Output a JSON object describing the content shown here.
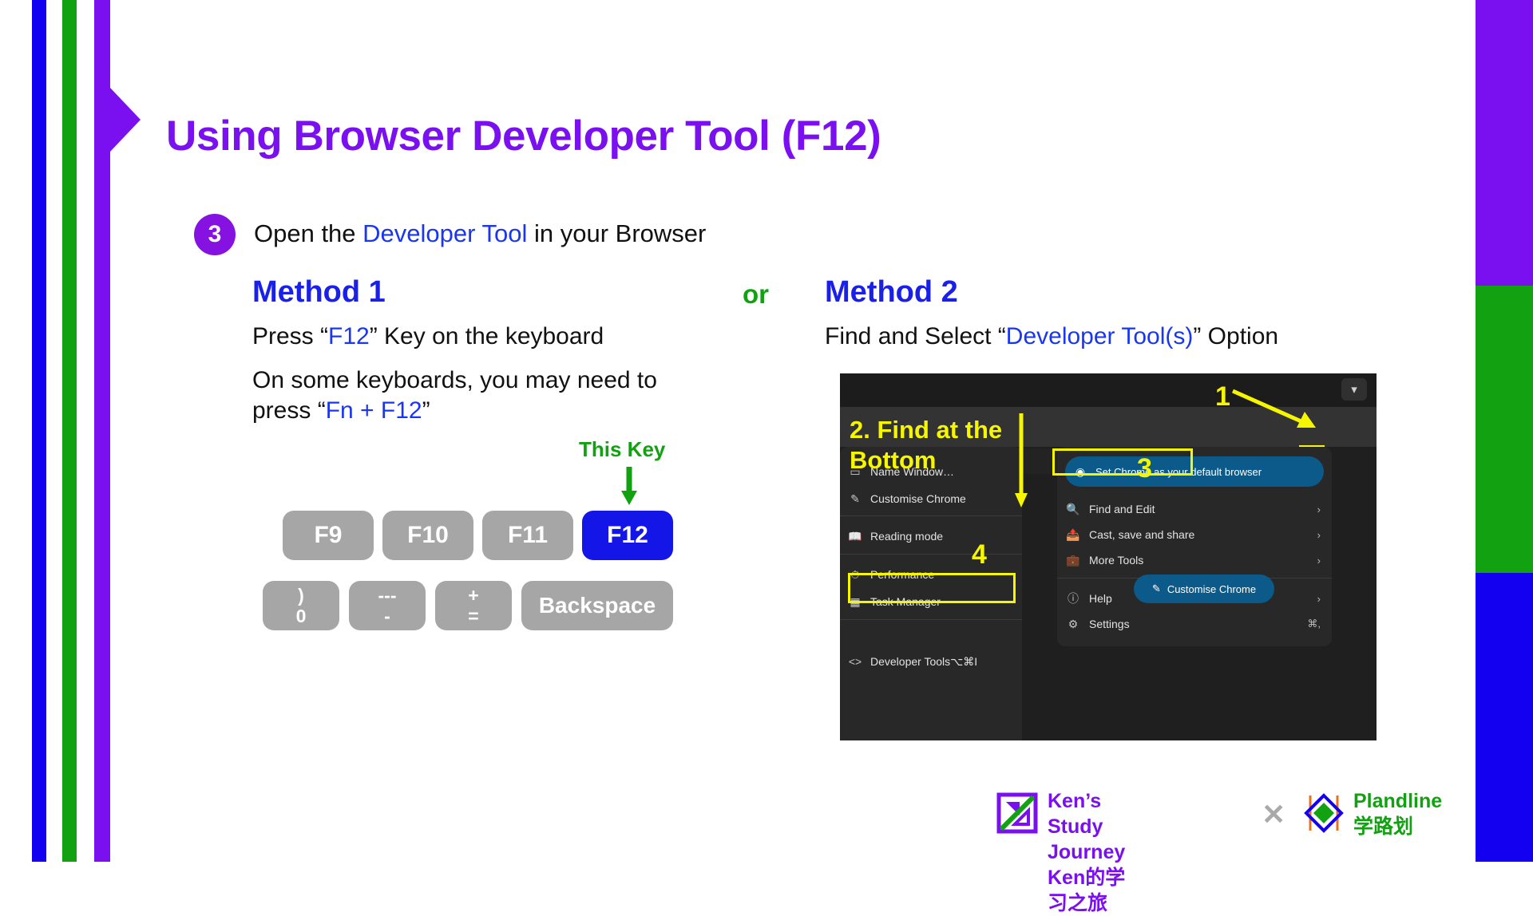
{
  "title": "Using Browser Developer Tool (F12)",
  "step": {
    "number": "3",
    "text_before": "Open the ",
    "highlight": "Developer Tool",
    "text_after": " in your Browser"
  },
  "methods": {
    "or_label": "or",
    "method1": {
      "heading": "Method 1",
      "line1_before": "Press “",
      "line1_key": "F12",
      "line1_after": "” Key on the keyboard",
      "line2_before": "On some keyboards, you may need to press “",
      "line2_key": "Fn + F12",
      "line2_after": "”"
    },
    "method2": {
      "heading": "Method 2",
      "line1_before": "Find and Select “",
      "line1_key": "Developer Tool(s)",
      "line1_after": "” Option"
    }
  },
  "keyboard": {
    "annotation_label": "This Key",
    "row1": [
      {
        "label": "F9",
        "highlighted": false
      },
      {
        "label": "F10",
        "highlighted": false
      },
      {
        "label": "F11",
        "highlighted": false
      },
      {
        "label": "F12",
        "highlighted": true
      }
    ],
    "row2": [
      {
        "top": ")",
        "bottom": "0"
      },
      {
        "top": "---",
        "bottom": "-"
      },
      {
        "top": "+",
        "bottom": "="
      },
      {
        "label": "Backspace"
      }
    ]
  },
  "chrome_menu": {
    "annotations": {
      "num1": "1",
      "find_at_bottom": "2. Find at the Bottom",
      "num3": "3",
      "num4": "4"
    },
    "toolbar": {
      "star_icon": "star-icon",
      "leaf_icon": "leaf-icon",
      "avatar_icon": "avatar-icon",
      "kebab_icon": "three-dot-menu-icon",
      "chevron_icon": "chevron-down-icon"
    },
    "left_menu": [
      {
        "icon": "window-icon",
        "label": "Name Window…"
      },
      {
        "icon": "pencil-icon",
        "label": "Customise Chrome"
      },
      {
        "icon": "book-icon",
        "label": "Reading mode"
      },
      {
        "icon": "gauge-icon",
        "label": "Performance"
      },
      {
        "icon": "grid-icon",
        "label": "Task Manager"
      },
      {
        "icon": "code-icon",
        "label": "Developer Tools",
        "shortcut": "⌥⌘I"
      }
    ],
    "default_browser_button": {
      "icon": "chrome-icon",
      "label": "Set Chrome as your default browser"
    },
    "submenu": [
      {
        "icon": "find-icon",
        "label": "Find and Edit",
        "arrow": "›"
      },
      {
        "icon": "cast-icon",
        "label": "Cast, save and share",
        "arrow": "›"
      },
      {
        "icon": "tools-icon",
        "label": "More Tools",
        "arrow": "›"
      },
      {
        "icon": "help-icon",
        "label": "Help",
        "arrow": "›"
      },
      {
        "icon": "gear-icon",
        "label": "Settings",
        "shortcut": "⌘,"
      }
    ],
    "customise_pill": {
      "icon": "pencil-icon",
      "label": "Customise Chrome"
    }
  },
  "footer": {
    "ken": {
      "line1": "Ken’s Study Journey",
      "line2": "Ken的学习之旅"
    },
    "separator": "✕",
    "plandline": {
      "line1": "Plandline",
      "line2": "学路划"
    }
  },
  "colors": {
    "purple": "#7a0ff0",
    "blue": "#1400f0",
    "green": "#11a111",
    "yellow": "#f6f600"
  }
}
